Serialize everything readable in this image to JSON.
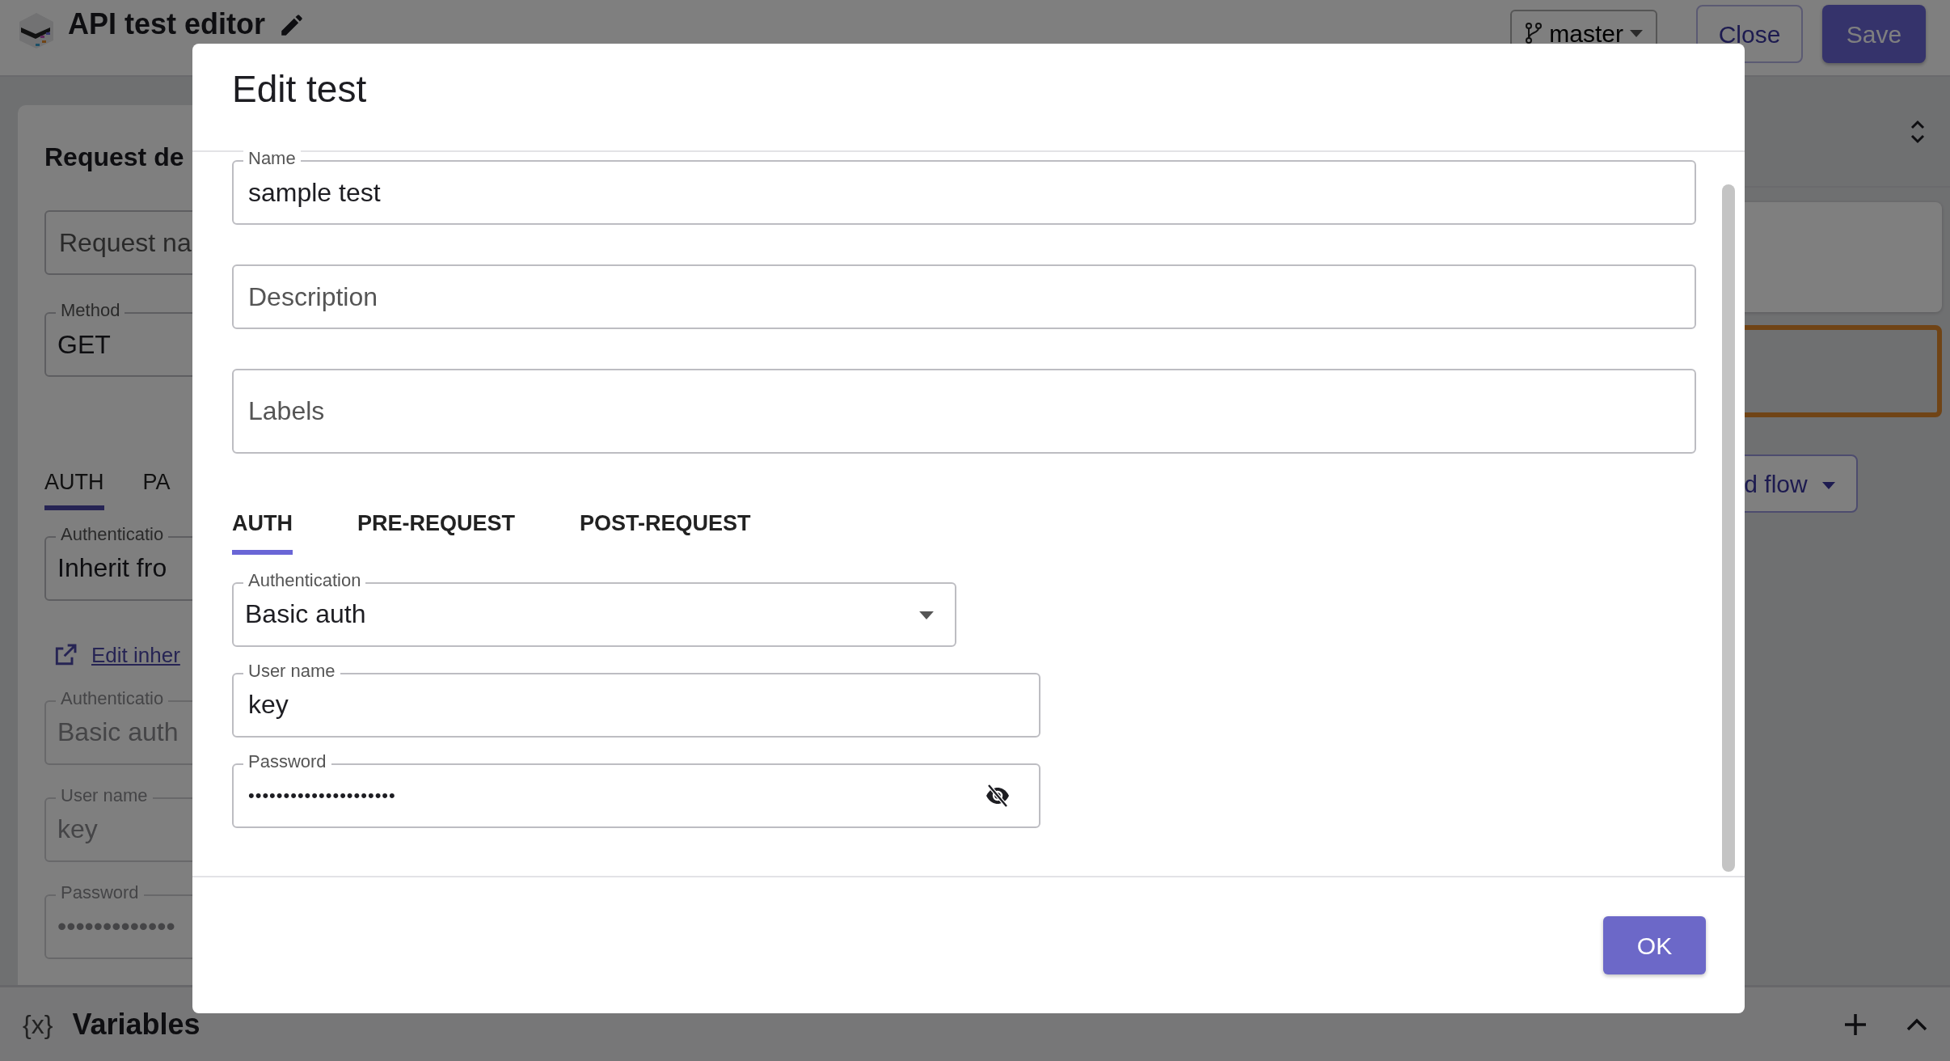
{
  "app_bar": {
    "title": "API test editor",
    "branch": "master",
    "buttons": [
      {
        "label": "Close",
        "kind": "outline"
      },
      {
        "label": "Save",
        "kind": "primary"
      }
    ]
  },
  "request_panel": {
    "title": "Request de",
    "name_placeholder": "Request na",
    "method": {
      "label": "Method",
      "value": "GET"
    },
    "tabs": [
      {
        "label": "AUTH",
        "selected": true
      },
      {
        "label": "PA",
        "selected": false
      }
    ],
    "auth": {
      "label": "Authenticatio",
      "value": "Inherit fro"
    },
    "edit_link": "Edit inher",
    "inherited": [
      {
        "label": "Authenticatio",
        "value": "Basic auth",
        "disabled": true
      },
      {
        "label": "User name",
        "value": "key",
        "disabled": true
      },
      {
        "label": "Password",
        "value": "•••••••••••••",
        "disabled": true
      }
    ]
  },
  "flow_button": "d flow",
  "variables_bar": {
    "icon_text": "{x}",
    "title": "Variables"
  },
  "dialog": {
    "title": "Edit test",
    "fields": [
      {
        "kind": "text",
        "label": "Name",
        "value": "sample test"
      },
      {
        "kind": "placeholder",
        "placeholder": "Description"
      },
      {
        "kind": "tall",
        "placeholder": "Labels"
      }
    ],
    "tabs": [
      {
        "label": "AUTH",
        "selected": true
      },
      {
        "label": "PRE-REQUEST",
        "selected": false
      },
      {
        "label": "POST-REQUEST",
        "selected": false
      }
    ],
    "auth_fields": [
      {
        "kind": "select",
        "label": "Authentication",
        "value": "Basic auth"
      },
      {
        "kind": "text",
        "label": "User name",
        "value": "key"
      },
      {
        "kind": "password",
        "label": "Password",
        "value": "•••••••••••••••••••••"
      }
    ],
    "ok": "OK"
  }
}
